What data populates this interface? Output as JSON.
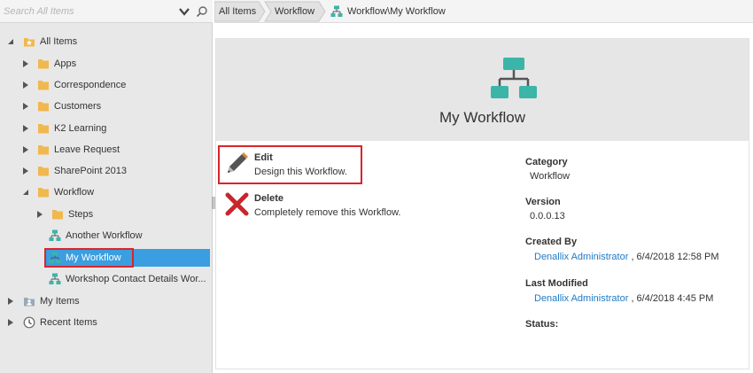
{
  "search": {
    "placeholder": "Search All Items"
  },
  "tree": {
    "all_items": "All Items",
    "apps": "Apps",
    "correspondence": "Correspondence",
    "customers": "Customers",
    "k2_learning": "K2 Learning",
    "leave_request": "Leave Request",
    "sharepoint_2013": "SharePoint 2013",
    "workflow": "Workflow",
    "steps": "Steps",
    "another_workflow": "Another Workflow",
    "my_workflow": "My Workflow",
    "workshop_contact": "Workshop Contact Details Wor...",
    "my_items": "My Items",
    "recent_items": "Recent Items"
  },
  "breadcrumb": {
    "all_items": "All Items",
    "workflow": "Workflow",
    "current": "Workflow\\My Workflow"
  },
  "hero": {
    "title": "My Workflow"
  },
  "actions": {
    "edit_title": "Edit",
    "edit_desc": "Design this Workflow.",
    "delete_title": "Delete",
    "delete_desc": "Completely remove this Workflow."
  },
  "details": {
    "category_label": "Category",
    "category_value": "Workflow",
    "version_label": "Version",
    "version_value": "0.0.0.13",
    "created_label": "Created By",
    "created_user": "Denallix Administrator",
    "created_date": ", 6/4/2018 12:58 PM",
    "modified_label": "Last Modified",
    "modified_user": "Denallix Administrator",
    "modified_date": ", 6/4/2018 4:45 PM",
    "status_label": "Status:"
  },
  "colors": {
    "accent": "#3a9ee0",
    "highlight": "#d9252b",
    "teal": "#3ab5a8",
    "folder": "#f0b84f",
    "link": "#1f7ac6"
  },
  "icons": [
    "chevron-down-icon",
    "search-icon",
    "star-folder-icon",
    "folder-icon",
    "workflow-icon",
    "my-items-icon",
    "recent-items-icon",
    "pencil-icon",
    "delete-x-icon"
  ]
}
